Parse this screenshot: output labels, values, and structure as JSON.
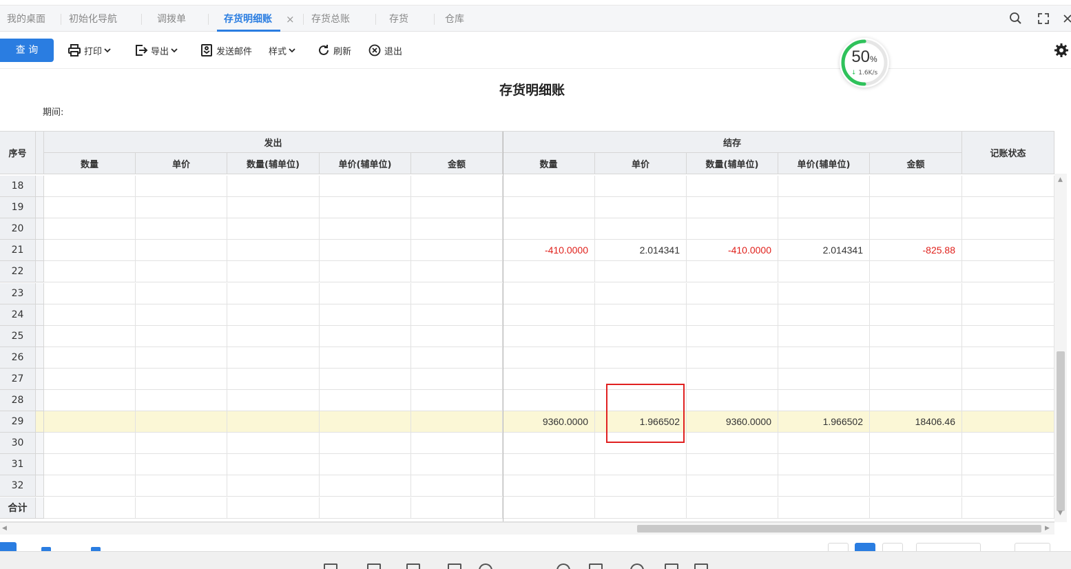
{
  "tabs": [
    {
      "label": "我的桌面",
      "active": false
    },
    {
      "label": "初始化导航",
      "active": false
    },
    {
      "label": "调拨单",
      "active": false
    },
    {
      "label": "存货明细账",
      "active": true
    },
    {
      "label": "存货总账",
      "active": false
    },
    {
      "label": "存货",
      "active": false
    },
    {
      "label": "仓库",
      "active": false
    }
  ],
  "tab_close_glyph": "×",
  "window_controls": [
    "search-icon",
    "fullscreen-icon",
    "close-icon"
  ],
  "toolbar": {
    "query_label": "查 询",
    "print_label": "打印",
    "export_label": "导出",
    "email_label": "发送邮件",
    "style_label": "样式",
    "refresh_label": "刷新",
    "exit_label": "退出"
  },
  "speed_gauge": {
    "percent_text": "50",
    "percent_sign": "%",
    "speed_text": "1.6K/s",
    "fraction": 0.5,
    "accent": "#2fc25b"
  },
  "report": {
    "title": "存货明细账",
    "period_label": "期间:"
  },
  "table": {
    "seq_header": "序号",
    "group_out": "发出",
    "group_balance": "结存",
    "status_header": "记账状态",
    "out_columns": [
      "数量",
      "单价",
      "数量(辅单位)",
      "单价(辅单位)",
      "金额"
    ],
    "balance_columns": [
      "数量",
      "单价",
      "数量(辅单位)",
      "单价(辅单位)",
      "金额"
    ],
    "rows": [
      {
        "seq": "18",
        "cells": [
          "",
          "",
          "",
          "",
          "",
          "",
          "",
          "",
          "",
          "",
          ""
        ]
      },
      {
        "seq": "19",
        "cells": [
          "",
          "",
          "",
          "",
          "",
          "",
          "",
          "",
          "",
          "",
          ""
        ]
      },
      {
        "seq": "20",
        "cells": [
          "",
          "",
          "",
          "",
          "",
          "",
          "",
          "",
          "",
          "",
          ""
        ]
      },
      {
        "seq": "21",
        "cells": [
          "",
          "",
          "",
          "",
          "",
          "-410.0000",
          "2.014341",
          "-410.0000",
          "2.014341",
          "-825.88",
          ""
        ]
      },
      {
        "seq": "22",
        "cells": [
          "",
          "",
          "",
          "",
          "",
          "",
          "",
          "",
          "",
          "",
          ""
        ]
      },
      {
        "seq": "23",
        "cells": [
          "",
          "",
          "",
          "",
          "",
          "",
          "",
          "",
          "",
          "",
          ""
        ]
      },
      {
        "seq": "24",
        "cells": [
          "",
          "",
          "",
          "",
          "",
          "",
          "",
          "",
          "",
          "",
          ""
        ]
      },
      {
        "seq": "25",
        "cells": [
          "",
          "",
          "",
          "",
          "",
          "",
          "",
          "",
          "",
          "",
          ""
        ]
      },
      {
        "seq": "26",
        "cells": [
          "",
          "",
          "",
          "",
          "",
          "",
          "",
          "",
          "",
          "",
          ""
        ]
      },
      {
        "seq": "27",
        "cells": [
          "",
          "",
          "",
          "",
          "",
          "",
          "",
          "",
          "",
          "",
          ""
        ]
      },
      {
        "seq": "28",
        "cells": [
          "",
          "",
          "",
          "",
          "",
          "",
          "",
          "",
          "",
          "",
          ""
        ]
      },
      {
        "seq": "29",
        "cells": [
          "",
          "",
          "",
          "",
          "",
          "9360.0000",
          "1.966502",
          "9360.0000",
          "1.966502",
          "18406.46",
          ""
        ],
        "highlight": true
      },
      {
        "seq": "30",
        "cells": [
          "",
          "",
          "",
          "",
          "",
          "",
          "",
          "",
          "",
          "",
          ""
        ]
      },
      {
        "seq": "31",
        "cells": [
          "",
          "",
          "",
          "",
          "",
          "",
          "",
          "",
          "",
          "",
          ""
        ]
      },
      {
        "seq": "32",
        "cells": [
          "",
          "",
          "",
          "",
          "",
          "",
          "",
          "",
          "",
          "",
          ""
        ]
      },
      {
        "seq": "合计",
        "cells": [
          "",
          "",
          "",
          "",
          "",
          "",
          "",
          "",
          "",
          "",
          ""
        ]
      }
    ]
  },
  "colors": {
    "accent": "#2a7de1",
    "negative": "#e0201b",
    "highlight_row": "#fbf7d6",
    "annotation_box": "#e02020"
  }
}
